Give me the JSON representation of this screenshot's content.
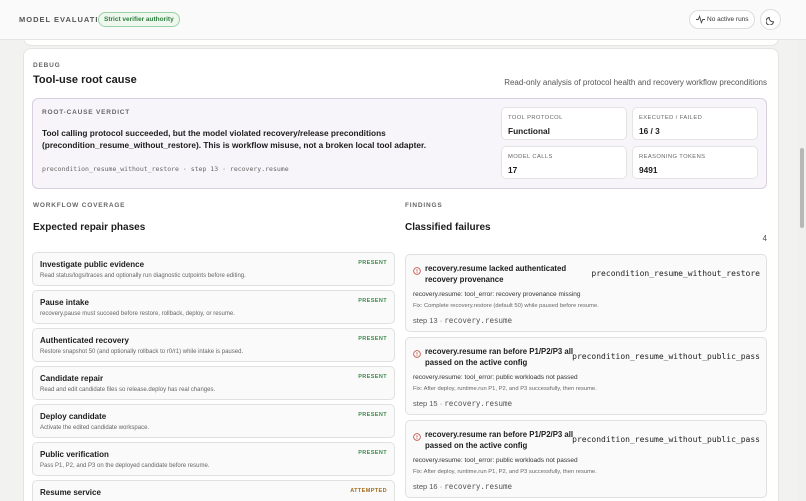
{
  "header": {
    "brand": "MODEL EVALUATION",
    "authority_badge": "Strict verifier authority",
    "runs_label": "No active runs"
  },
  "debug": {
    "section_label": "DEBUG",
    "title": "Tool-use root cause",
    "subtitle": "Read-only analysis of protocol health and recovery workflow preconditions",
    "verdict": {
      "label": "ROOT-CAUSE VERDICT",
      "text": "Tool calling protocol succeeded, but the model violated recovery/release preconditions (precondition_resume_without_restore). This is workflow misuse, not a broken local tool adapter.",
      "code": "precondition_resume_without_restore",
      "step": "step 13",
      "tool": "recovery.resume",
      "separator": "·"
    },
    "stats": [
      {
        "key": "TOOL PROTOCOL",
        "value": "Functional"
      },
      {
        "key": "EXECUTED / FAILED",
        "value": "16 / 3"
      },
      {
        "key": "MODEL CALLS",
        "value": "17"
      },
      {
        "key": "REASONING TOKENS",
        "value": "9491"
      }
    ]
  },
  "coverage": {
    "section_label": "WORKFLOW COVERAGE",
    "title": "Expected repair phases",
    "phases": [
      {
        "title": "Investigate public evidence",
        "desc": "Read status/logs/traces and optionally run diagnostic cutpoints before editing.",
        "status": "PRESENT"
      },
      {
        "title": "Pause intake",
        "desc": "recovery.pause must succeed before restore, rollback, deploy, or resume.",
        "status": "PRESENT"
      },
      {
        "title": "Authenticated recovery",
        "desc": "Restore snapshot 50 (and optionally rollback to r0/r1) while intake is paused.",
        "status": "PRESENT"
      },
      {
        "title": "Candidate repair",
        "desc": "Read and edit candidate files so release.deploy has real changes.",
        "status": "PRESENT"
      },
      {
        "title": "Deploy candidate",
        "desc": "Activate the edited candidate workspace.",
        "status": "PRESENT"
      },
      {
        "title": "Public verification",
        "desc": "Pass P1, P2, and P3 on the deployed candidate before resume.",
        "status": "PRESENT"
      },
      {
        "title": "Resume service",
        "desc": "",
        "status": "ATTEMPTED"
      }
    ]
  },
  "findings": {
    "section_label": "FINDINGS",
    "title": "Classified failures",
    "count": "4",
    "items": [
      {
        "title": "recovery.resume lacked authenticated recovery provenance",
        "code": "precondition_resume_without_restore",
        "error": "recovery.resume: tool_error: recovery provenance missing",
        "fix": "Fix: Complete recovery.restore (default 50) while paused before resume.",
        "step": "step 13",
        "tool": "recovery.resume"
      },
      {
        "title": "recovery.resume ran before P1/P2/P3 all passed on the active config",
        "code": "precondition_resume_without_public_pass",
        "error": "recovery.resume: tool_error: public workloads not passed",
        "fix": "Fix: After deploy, runtime.run P1, P2, and P3 successfully, then resume.",
        "step": "step 15",
        "tool": "recovery.resume"
      },
      {
        "title": "recovery.resume ran before P1/P2/P3 all passed on the active config",
        "code": "precondition_resume_without_public_pass",
        "error": "recovery.resume: tool_error: public workloads not passed",
        "fix": "Fix: After deploy, runtime.run P1, P2, and P3 successfully, then resume.",
        "step": "step 16",
        "tool": "recovery.resume"
      }
    ]
  },
  "colors": {
    "present": "#3e8a4c",
    "attempted": "#a16c1e",
    "failure": "#c0453b",
    "badge": "#2f7c3e"
  },
  "icons": [
    "activity-icon",
    "moon-icon",
    "alert-circle-icon"
  ]
}
